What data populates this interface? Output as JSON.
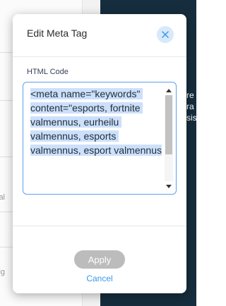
{
  "dialog": {
    "title": "Edit Meta Tag",
    "close_icon": "close-icon",
    "field_label": "HTML Code",
    "code_value": "<meta name=\"keywords\" content=\"esports, fortnite valmennus, eurheilu valmennus, esports valmennus, esport valmennus",
    "apply_label": "Apply",
    "cancel_label": "Cancel"
  },
  "background": {
    "right_fragments": [
      "re",
      "ra",
      "sis"
    ],
    "left_fragments": [
      "al",
      "ig"
    ]
  },
  "colors": {
    "accent": "#3899ec",
    "close_bg": "#d8e9fb",
    "apply_disabled": "#bcbcbc",
    "selection": "#cde0fb",
    "dark_bg": "#162d3d"
  }
}
